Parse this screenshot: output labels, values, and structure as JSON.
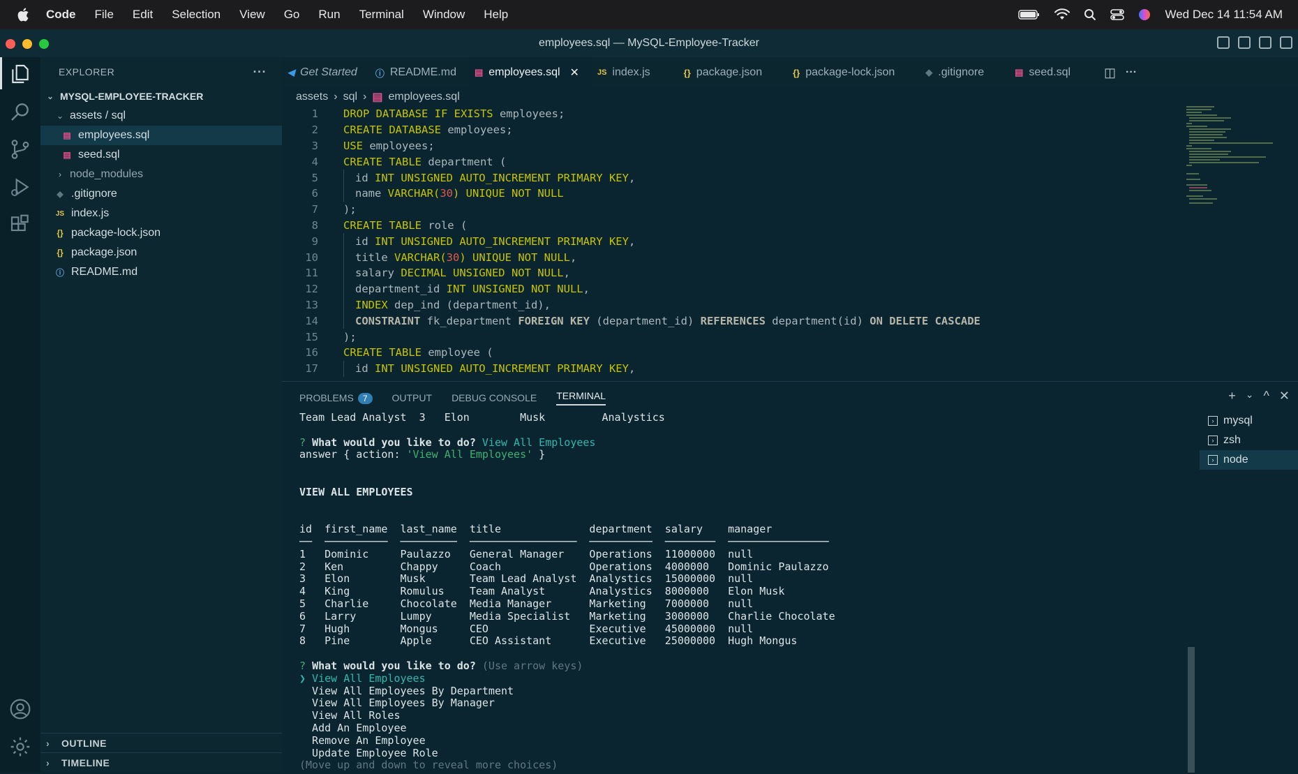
{
  "menubar": {
    "items": [
      "Code",
      "File",
      "Edit",
      "Selection",
      "View",
      "Go",
      "Run",
      "Terminal",
      "Window",
      "Help"
    ],
    "clock": "Wed Dec 14  11:54 AM"
  },
  "window": {
    "title": "employees.sql — MySQL-Employee-Tracker"
  },
  "sidebar": {
    "header": "EXPLORER",
    "more": "···",
    "project": "MYSQL-EMPLOYEE-TRACKER",
    "folder": "assets / sql",
    "files_in_folder": [
      "employees.sql",
      "seed.sql"
    ],
    "node_modules": "node_modules",
    "root_files": [
      {
        "icon": "◆",
        "name": ".gitignore"
      },
      {
        "icon": "JS",
        "name": "index.js"
      },
      {
        "icon": "{}",
        "name": "package-lock.json"
      },
      {
        "icon": "{}",
        "name": "package.json"
      },
      {
        "icon": "ⓘ",
        "name": "README.md"
      }
    ],
    "outline": "OUTLINE",
    "timeline": "TIMELINE"
  },
  "tabs": [
    {
      "icon": "◀",
      "label": "Get Started"
    },
    {
      "icon": "ⓘ",
      "label": "README.md"
    },
    {
      "icon": "▤",
      "label": "employees.sql"
    },
    {
      "icon": "JS",
      "label": "index.js"
    },
    {
      "icon": "{}",
      "label": "package.json"
    },
    {
      "icon": "{}",
      "label": "package-lock.json"
    },
    {
      "icon": "◆",
      "label": ".gitignore"
    },
    {
      "icon": "▤",
      "label": "seed.sql"
    }
  ],
  "breadcrumb": [
    "assets",
    "sql",
    "employees.sql"
  ],
  "editor": {
    "lines": [
      {
        "n": "1",
        "indent": 0,
        "t": [
          [
            "kw",
            "DROP DATABASE IF EXISTS"
          ],
          [
            "code",
            " employees;"
          ]
        ]
      },
      {
        "n": "2",
        "indent": 0,
        "t": [
          [
            "kw",
            "CREATE DATABASE"
          ],
          [
            "code",
            " employees;"
          ]
        ]
      },
      {
        "n": "3",
        "indent": 0,
        "t": [
          [
            "kw",
            "USE"
          ],
          [
            "code",
            " employees;"
          ]
        ]
      },
      {
        "n": "4",
        "indent": 0,
        "t": [
          [
            "kw",
            "CREATE TABLE"
          ],
          [
            "code",
            " department ("
          ]
        ]
      },
      {
        "n": "5",
        "indent": 1,
        "t": [
          [
            "code",
            "id "
          ],
          [
            "kw",
            "INT UNSIGNED AUTO_INCREMENT PRIMARY KEY"
          ],
          [
            "code",
            ","
          ]
        ]
      },
      {
        "n": "6",
        "indent": 1,
        "t": [
          [
            "code",
            "name "
          ],
          [
            "kw",
            "VARCHAR("
          ],
          [
            "num",
            "30"
          ],
          [
            "kw",
            ") UNIQUE NOT NULL"
          ]
        ]
      },
      {
        "n": "7",
        "indent": 0,
        "t": [
          [
            "code",
            ");"
          ]
        ]
      },
      {
        "n": "8",
        "indent": 0,
        "t": [
          [
            "kw",
            "CREATE TABLE"
          ],
          [
            "code",
            " role ("
          ]
        ]
      },
      {
        "n": "9",
        "indent": 1,
        "t": [
          [
            "code",
            "id "
          ],
          [
            "kw",
            "INT UNSIGNED AUTO_INCREMENT PRIMARY KEY"
          ],
          [
            "code",
            ","
          ]
        ]
      },
      {
        "n": "10",
        "indent": 1,
        "t": [
          [
            "code",
            "title "
          ],
          [
            "kw",
            "VARCHAR("
          ],
          [
            "num",
            "30"
          ],
          [
            "kw",
            ") UNIQUE NOT NULL"
          ],
          [
            "code",
            ","
          ]
        ]
      },
      {
        "n": "11",
        "indent": 1,
        "t": [
          [
            "code",
            "salary "
          ],
          [
            "kw",
            "DECIMAL UNSIGNED NOT NULL"
          ],
          [
            "code",
            ","
          ]
        ]
      },
      {
        "n": "12",
        "indent": 1,
        "t": [
          [
            "code",
            "department_id "
          ],
          [
            "kw",
            "INT UNSIGNED NOT NULL"
          ],
          [
            "code",
            ","
          ]
        ]
      },
      {
        "n": "13",
        "indent": 1,
        "t": [
          [
            "kw",
            "INDEX"
          ],
          [
            "code",
            " dep_ind (department_id),"
          ]
        ]
      },
      {
        "n": "14",
        "indent": 1,
        "t": [
          [
            "kw2",
            "CONSTRAINT"
          ],
          [
            "code",
            " fk_department "
          ],
          [
            "kw2",
            "FOREIGN KEY"
          ],
          [
            "code",
            " (department_id) "
          ],
          [
            "kw2",
            "REFERENCES"
          ],
          [
            "code",
            " department(id) "
          ],
          [
            "kw2",
            "ON DELETE CASCADE"
          ]
        ]
      },
      {
        "n": "15",
        "indent": 0,
        "t": [
          [
            "code",
            ");"
          ]
        ]
      },
      {
        "n": "16",
        "indent": 0,
        "t": [
          [
            "kw",
            "CREATE TABLE"
          ],
          [
            "code",
            " employee ("
          ]
        ]
      },
      {
        "n": "17",
        "indent": 1,
        "t": [
          [
            "code",
            "id "
          ],
          [
            "kw",
            "INT UNSIGNED AUTO_INCREMENT PRIMARY KEY"
          ],
          [
            "code",
            ","
          ]
        ]
      }
    ]
  },
  "panel": {
    "tabs": [
      "PROBLEMS",
      "OUTPUT",
      "DEBUG CONSOLE",
      "TERMINAL"
    ],
    "problems_count": "7",
    "actions": [
      "+",
      "⌄",
      "^",
      "✕"
    ],
    "terminals": [
      "mysql",
      "zsh",
      "node"
    ]
  },
  "terminal": {
    "lines": [
      [
        [
          "",
          "Team Lead Analyst  3   Elon        Musk         Analystics"
        ]
      ],
      [
        [
          "",
          " "
        ]
      ],
      [
        [
          "q",
          "? "
        ],
        [
          "b",
          "What would you like to do? "
        ],
        [
          "cy",
          "View All Employees"
        ]
      ],
      [
        [
          "",
          "answer { action: "
        ],
        [
          "q",
          "'View All Employees'"
        ],
        [
          "",
          " }"
        ]
      ],
      [
        [
          "",
          " "
        ]
      ],
      [
        [
          "",
          " "
        ]
      ],
      [
        [
          "b",
          "VIEW ALL EMPLOYEES"
        ]
      ],
      [
        [
          "",
          " "
        ]
      ],
      [
        [
          "",
          " "
        ]
      ],
      [
        [
          "",
          "id  first_name  last_name  title              department  salary    manager"
        ]
      ],
      [
        [
          "",
          "──  ──────────  ─────────  ─────────────────  ──────────  ────────  ────────────────"
        ]
      ],
      [
        [
          "",
          "1   Dominic     Paulazzo   General Manager    Operations  11000000  null"
        ]
      ],
      [
        [
          "",
          "2   Ken         Chappy     Coach              Operations  4000000   Dominic Paulazzo"
        ]
      ],
      [
        [
          "",
          "3   Elon        Musk       Team Lead Analyst  Analystics  15000000  null"
        ]
      ],
      [
        [
          "",
          "4   King        Romulus    Team Analyst       Analystics  8000000   Elon Musk"
        ]
      ],
      [
        [
          "",
          "5   Charlie     Chocolate  Media Manager      Marketing   7000000   null"
        ]
      ],
      [
        [
          "",
          "6   Larry       Lumpy      Media Specialist   Marketing   3000000   Charlie Chocolate"
        ]
      ],
      [
        [
          "",
          "7   Hugh        Mongus     CEO                Executive   45000000  null"
        ]
      ],
      [
        [
          "",
          "8   Pine        Apple      CEO Assistant      Executive   25000000  Hugh Mongus"
        ]
      ],
      [
        [
          "",
          " "
        ]
      ],
      [
        [
          "q",
          "? "
        ],
        [
          "b",
          "What would you like to do? "
        ],
        [
          "dim",
          "(Use arrow keys)"
        ]
      ],
      [
        [
          "cy",
          "❯ View All Employees"
        ]
      ],
      [
        [
          "",
          "  View All Employees By Department"
        ]
      ],
      [
        [
          "",
          "  View All Employees By Manager"
        ]
      ],
      [
        [
          "",
          "  View All Roles"
        ]
      ],
      [
        [
          "",
          "  Add An Employee"
        ]
      ],
      [
        [
          "",
          "  Remove An Employee"
        ]
      ],
      [
        [
          "",
          "  Update Employee Role"
        ]
      ],
      [
        [
          "dim",
          "(Move up and down to reveal more choices)"
        ]
      ]
    ]
  },
  "colors": {
    "editor_bg": "#0b2530",
    "keyword": "#c7c400",
    "number": "#e05a4a",
    "prompt_green": "#3bb26f",
    "answer_cyan": "#2eb8b0"
  }
}
